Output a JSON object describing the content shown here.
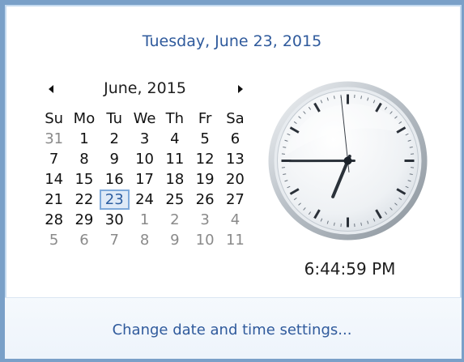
{
  "header": {
    "full_date": "Tuesday, June 23, 2015"
  },
  "calendar": {
    "month_label": "June, 2015",
    "prev_icon": "triangle-left-icon",
    "next_icon": "triangle-right-icon",
    "weekdays": [
      "Su",
      "Mo",
      "Tu",
      "We",
      "Th",
      "Fr",
      "Sa"
    ],
    "weeks": [
      [
        {
          "d": "31",
          "o": true
        },
        {
          "d": "1"
        },
        {
          "d": "2"
        },
        {
          "d": "3"
        },
        {
          "d": "4"
        },
        {
          "d": "5"
        },
        {
          "d": "6"
        }
      ],
      [
        {
          "d": "7"
        },
        {
          "d": "8"
        },
        {
          "d": "9"
        },
        {
          "d": "10"
        },
        {
          "d": "11"
        },
        {
          "d": "12"
        },
        {
          "d": "13"
        }
      ],
      [
        {
          "d": "14"
        },
        {
          "d": "15"
        },
        {
          "d": "16"
        },
        {
          "d": "17"
        },
        {
          "d": "18"
        },
        {
          "d": "19"
        },
        {
          "d": "20"
        }
      ],
      [
        {
          "d": "21"
        },
        {
          "d": "22"
        },
        {
          "d": "23",
          "today": true
        },
        {
          "d": "24"
        },
        {
          "d": "25"
        },
        {
          "d": "26"
        },
        {
          "d": "27"
        }
      ],
      [
        {
          "d": "28"
        },
        {
          "d": "29"
        },
        {
          "d": "30"
        },
        {
          "d": "1",
          "o": true
        },
        {
          "d": "2",
          "o": true
        },
        {
          "d": "3",
          "o": true
        },
        {
          "d": "4",
          "o": true
        }
      ],
      [
        {
          "d": "5",
          "o": true
        },
        {
          "d": "6",
          "o": true
        },
        {
          "d": "7",
          "o": true
        },
        {
          "d": "8",
          "o": true
        },
        {
          "d": "9",
          "o": true
        },
        {
          "d": "10",
          "o": true
        },
        {
          "d": "11",
          "o": true
        }
      ]
    ]
  },
  "clock": {
    "hours": 6,
    "minutes": 44,
    "seconds": 59,
    "time_text": "6:44:59 PM"
  },
  "footer": {
    "link_label": "Change date and time settings..."
  },
  "colors": {
    "accent": "#2f5a9c",
    "frame": "#7aa0c8",
    "today_fill": "#dfeaf7"
  }
}
